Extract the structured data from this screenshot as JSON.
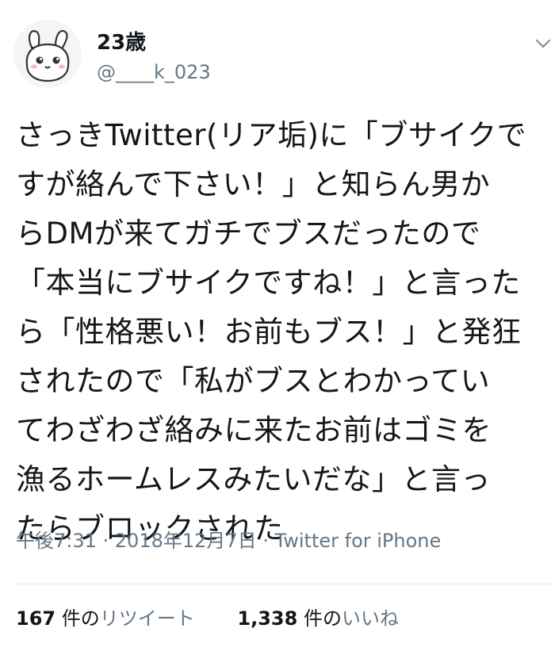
{
  "user": {
    "display_name": "23歳",
    "handle": "@____k_023"
  },
  "icons": {
    "avatar": "bunny-face-avatar",
    "menu": "chevron-down-icon"
  },
  "tweet": {
    "lines": [
      "さっきTwitter(リア垢)に「ブサイクで",
      "すが絡んで下さい！」と知らん男か",
      "らDMが来てガチでブスだったので",
      "「本当にブサイクですね！」と言った",
      "ら「性格悪い！お前もブス！」と発狂",
      "されたので「私がブスとわかってい",
      "てわざわざ絡みに来たお前はゴミを",
      "漁るホームレスみたいだな」と言っ",
      "たらブロックされた"
    ]
  },
  "meta": {
    "text": "午後7:31 · 2018年12月7日 · Twitter for iPhone"
  },
  "stats": {
    "retweets": {
      "count": "167",
      "unit": "件の",
      "label": "リツイート"
    },
    "likes": {
      "count": "1,338",
      "unit": "件の",
      "label": "いいね"
    }
  },
  "colors": {
    "text": "#14171a",
    "secondary": "#657786",
    "divider": "#e1e8ed"
  }
}
